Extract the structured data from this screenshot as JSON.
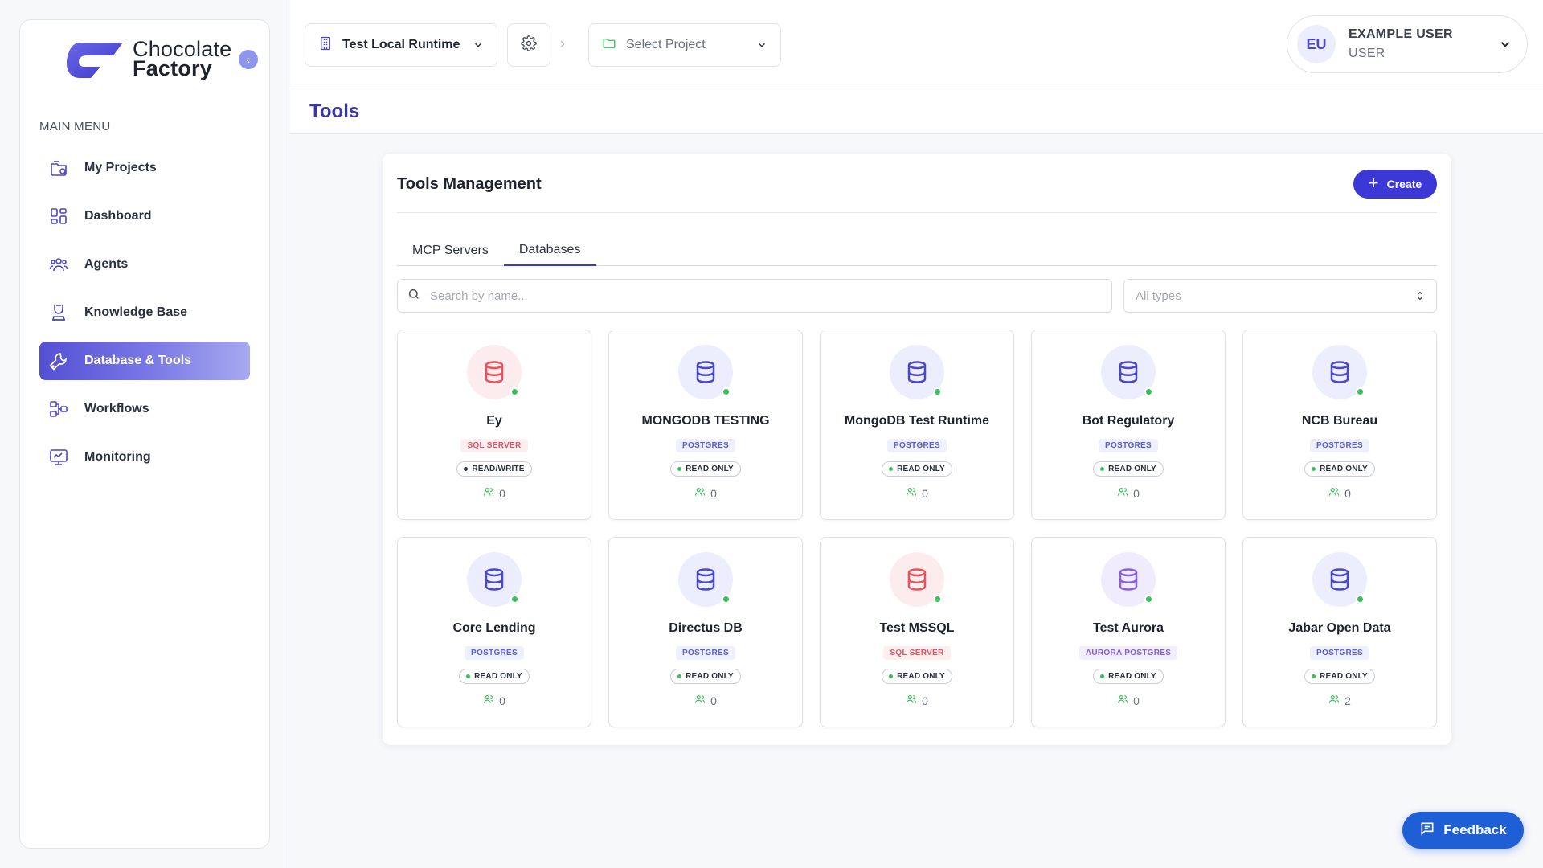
{
  "brand": {
    "line1": "Chocolate",
    "line2": "Factory",
    "color": "#4b47d6"
  },
  "sidebar": {
    "menu_title": "MAIN MENU",
    "items": [
      {
        "label": "My Projects",
        "icon": "projects-icon",
        "active": false
      },
      {
        "label": "Dashboard",
        "icon": "dashboard-icon",
        "active": false
      },
      {
        "label": "Agents",
        "icon": "agents-icon",
        "active": false
      },
      {
        "label": "Knowledge Base",
        "icon": "knowledge-base-icon",
        "active": false
      },
      {
        "label": "Database & Tools",
        "icon": "wrench-icon",
        "active": true
      },
      {
        "label": "Workflows",
        "icon": "workflow-icon",
        "active": false
      },
      {
        "label": "Monitoring",
        "icon": "monitor-icon",
        "active": false
      }
    ]
  },
  "topbar": {
    "runtime": "Test Local Runtime",
    "project_placeholder": "Select Project",
    "user": {
      "initials": "EU",
      "name": "EXAMPLE USER",
      "role": "USER"
    }
  },
  "page": {
    "title": "Tools"
  },
  "panel": {
    "title": "Tools Management",
    "create_label": "Create",
    "tabs": [
      {
        "label": "MCP Servers",
        "active": false
      },
      {
        "label": "Databases",
        "active": true
      }
    ],
    "search_placeholder": "Search by name...",
    "type_filter": "All types"
  },
  "cards": [
    {
      "name": "Ey",
      "type": "SQL SERVER",
      "access": "READ/WRITE",
      "users": "0",
      "icon_color": "red"
    },
    {
      "name": "MONGODB TESTING",
      "type": "POSTGRES",
      "access": "READ ONLY",
      "users": "0",
      "icon_color": "blue"
    },
    {
      "name": "MongoDB Test Runtime",
      "type": "POSTGRES",
      "access": "READ ONLY",
      "users": "0",
      "icon_color": "blue"
    },
    {
      "name": "Bot Regulatory",
      "type": "POSTGRES",
      "access": "READ ONLY",
      "users": "0",
      "icon_color": "blue"
    },
    {
      "name": "NCB Bureau",
      "type": "POSTGRES",
      "access": "READ ONLY",
      "users": "0",
      "icon_color": "blue"
    },
    {
      "name": "Core Lending",
      "type": "POSTGRES",
      "access": "READ ONLY",
      "users": "0",
      "icon_color": "blue"
    },
    {
      "name": "Directus DB",
      "type": "POSTGRES",
      "access": "READ ONLY",
      "users": "0",
      "icon_color": "blue"
    },
    {
      "name": "Test MSSQL",
      "type": "SQL SERVER",
      "access": "READ ONLY",
      "users": "0",
      "icon_color": "red"
    },
    {
      "name": "Test Aurora",
      "type": "AURORA POSTGRES",
      "access": "READ ONLY",
      "users": "0",
      "icon_color": "purple"
    },
    {
      "name": "Jabar Open Data",
      "type": "POSTGRES",
      "access": "READ ONLY",
      "users": "2",
      "icon_color": "blue"
    }
  ],
  "feedback_label": "Feedback",
  "colors": {
    "accent": "#3b38d6",
    "online": "#3bbf5a",
    "feedback": "#1f5fd6"
  }
}
